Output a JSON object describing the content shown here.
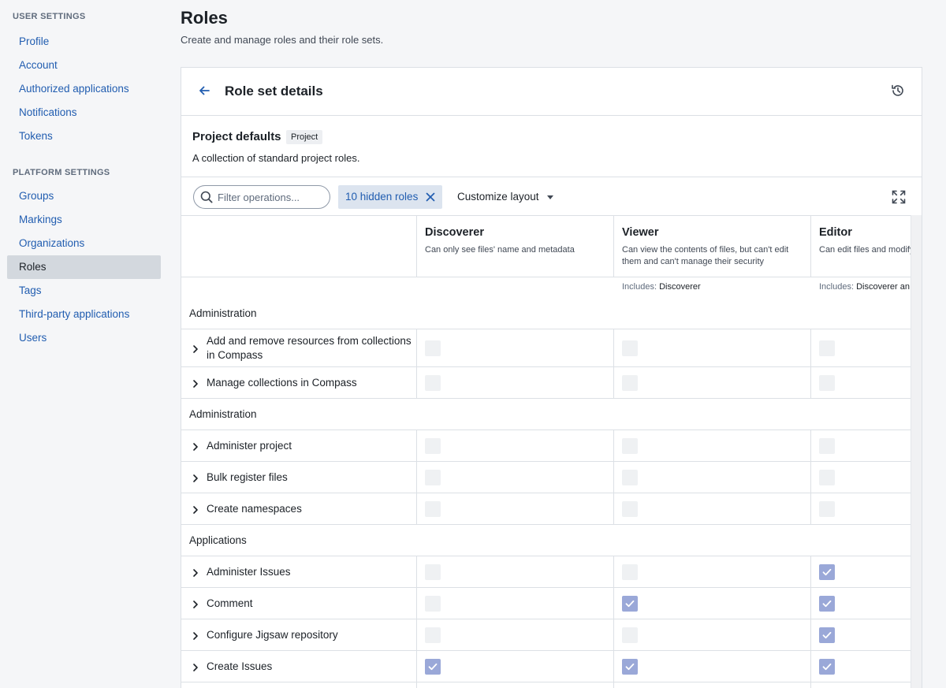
{
  "sidebar": {
    "user_settings_title": "USER SETTINGS",
    "user_items": [
      {
        "label": "Profile"
      },
      {
        "label": "Account"
      },
      {
        "label": "Authorized applications"
      },
      {
        "label": "Notifications"
      },
      {
        "label": "Tokens"
      }
    ],
    "platform_settings_title": "PLATFORM SETTINGS",
    "platform_items": [
      {
        "label": "Groups"
      },
      {
        "label": "Markings"
      },
      {
        "label": "Organizations"
      },
      {
        "label": "Roles",
        "active": true
      },
      {
        "label": "Tags"
      },
      {
        "label": "Third-party applications"
      },
      {
        "label": "Users"
      }
    ]
  },
  "page": {
    "title": "Roles",
    "subtitle": "Create and manage roles and their role sets."
  },
  "card": {
    "title": "Role set details",
    "roleset_name": "Project defaults",
    "roleset_tag": "Project",
    "roleset_desc": "A collection of standard project roles."
  },
  "toolbar": {
    "filter_placeholder": "Filter operations...",
    "filter_value": "",
    "hidden_roles_label": "10 hidden roles",
    "customize_label": "Customize layout"
  },
  "roles": [
    {
      "name": "Discoverer",
      "desc": "Can only see files' name and metadata",
      "includes_label": "",
      "includes": ""
    },
    {
      "name": "Viewer",
      "desc": "Can view the contents of files, but can't edit them and can't manage their security",
      "includes_label": "Includes:",
      "includes": "Discoverer"
    },
    {
      "name": "Editor",
      "desc": "Can edit files and modify",
      "includes_label": "Includes:",
      "includes": "Discoverer an"
    }
  ],
  "sections": [
    {
      "title": "Administration",
      "rows": [
        {
          "label": "Add and remove resources from collections in Compass",
          "perms": [
            false,
            false,
            false
          ]
        },
        {
          "label": "Manage collections in Compass",
          "perms": [
            false,
            false,
            false
          ]
        }
      ]
    },
    {
      "title": "Administration",
      "rows": [
        {
          "label": "Administer project",
          "perms": [
            false,
            false,
            false
          ]
        },
        {
          "label": "Bulk register files",
          "perms": [
            false,
            false,
            false
          ]
        },
        {
          "label": "Create namespaces",
          "perms": [
            false,
            false,
            false
          ]
        }
      ]
    },
    {
      "title": "Applications",
      "rows": [
        {
          "label": "Administer Issues",
          "perms": [
            false,
            false,
            true
          ]
        },
        {
          "label": "Comment",
          "perms": [
            false,
            true,
            true
          ]
        },
        {
          "label": "Configure Jigsaw repository",
          "perms": [
            false,
            false,
            true
          ]
        },
        {
          "label": "Create Issues",
          "perms": [
            true,
            true,
            true
          ]
        },
        {
          "label": "",
          "perms": [
            false,
            false,
            false
          ]
        }
      ]
    }
  ],
  "colors": {
    "link": "#215db0",
    "checked": "#9aa8d8",
    "unchecked": "#eff1f3",
    "active_nav": "#d3d8de"
  }
}
